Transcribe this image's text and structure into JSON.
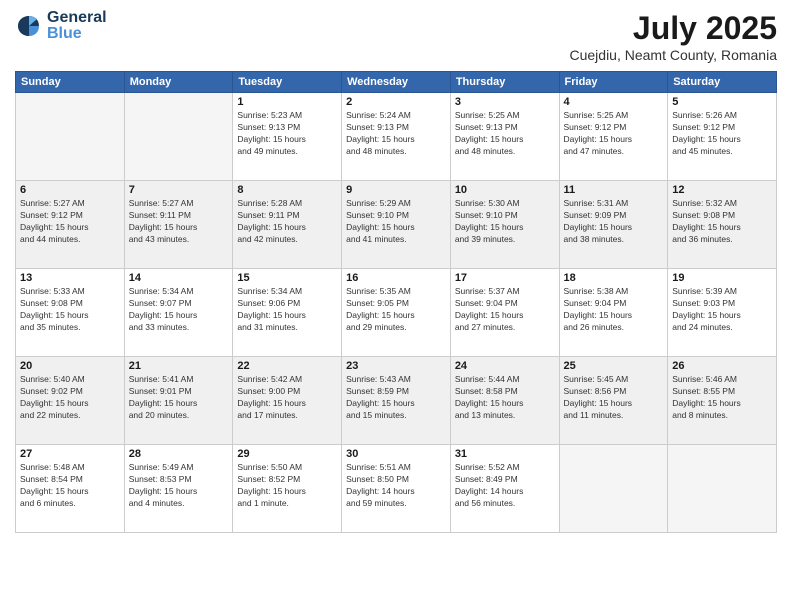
{
  "logo": {
    "general": "General",
    "blue": "Blue"
  },
  "header": {
    "month_year": "July 2025",
    "location": "Cuejdiu, Neamt County, Romania"
  },
  "weekdays": [
    "Sunday",
    "Monday",
    "Tuesday",
    "Wednesday",
    "Thursday",
    "Friday",
    "Saturday"
  ],
  "weeks": [
    [
      {
        "day": "",
        "info": ""
      },
      {
        "day": "",
        "info": ""
      },
      {
        "day": "1",
        "info": "Sunrise: 5:23 AM\nSunset: 9:13 PM\nDaylight: 15 hours\nand 49 minutes."
      },
      {
        "day": "2",
        "info": "Sunrise: 5:24 AM\nSunset: 9:13 PM\nDaylight: 15 hours\nand 48 minutes."
      },
      {
        "day": "3",
        "info": "Sunrise: 5:25 AM\nSunset: 9:13 PM\nDaylight: 15 hours\nand 48 minutes."
      },
      {
        "day": "4",
        "info": "Sunrise: 5:25 AM\nSunset: 9:12 PM\nDaylight: 15 hours\nand 47 minutes."
      },
      {
        "day": "5",
        "info": "Sunrise: 5:26 AM\nSunset: 9:12 PM\nDaylight: 15 hours\nand 45 minutes."
      }
    ],
    [
      {
        "day": "6",
        "info": "Sunrise: 5:27 AM\nSunset: 9:12 PM\nDaylight: 15 hours\nand 44 minutes."
      },
      {
        "day": "7",
        "info": "Sunrise: 5:27 AM\nSunset: 9:11 PM\nDaylight: 15 hours\nand 43 minutes."
      },
      {
        "day": "8",
        "info": "Sunrise: 5:28 AM\nSunset: 9:11 PM\nDaylight: 15 hours\nand 42 minutes."
      },
      {
        "day": "9",
        "info": "Sunrise: 5:29 AM\nSunset: 9:10 PM\nDaylight: 15 hours\nand 41 minutes."
      },
      {
        "day": "10",
        "info": "Sunrise: 5:30 AM\nSunset: 9:10 PM\nDaylight: 15 hours\nand 39 minutes."
      },
      {
        "day": "11",
        "info": "Sunrise: 5:31 AM\nSunset: 9:09 PM\nDaylight: 15 hours\nand 38 minutes."
      },
      {
        "day": "12",
        "info": "Sunrise: 5:32 AM\nSunset: 9:08 PM\nDaylight: 15 hours\nand 36 minutes."
      }
    ],
    [
      {
        "day": "13",
        "info": "Sunrise: 5:33 AM\nSunset: 9:08 PM\nDaylight: 15 hours\nand 35 minutes."
      },
      {
        "day": "14",
        "info": "Sunrise: 5:34 AM\nSunset: 9:07 PM\nDaylight: 15 hours\nand 33 minutes."
      },
      {
        "day": "15",
        "info": "Sunrise: 5:34 AM\nSunset: 9:06 PM\nDaylight: 15 hours\nand 31 minutes."
      },
      {
        "day": "16",
        "info": "Sunrise: 5:35 AM\nSunset: 9:05 PM\nDaylight: 15 hours\nand 29 minutes."
      },
      {
        "day": "17",
        "info": "Sunrise: 5:37 AM\nSunset: 9:04 PM\nDaylight: 15 hours\nand 27 minutes."
      },
      {
        "day": "18",
        "info": "Sunrise: 5:38 AM\nSunset: 9:04 PM\nDaylight: 15 hours\nand 26 minutes."
      },
      {
        "day": "19",
        "info": "Sunrise: 5:39 AM\nSunset: 9:03 PM\nDaylight: 15 hours\nand 24 minutes."
      }
    ],
    [
      {
        "day": "20",
        "info": "Sunrise: 5:40 AM\nSunset: 9:02 PM\nDaylight: 15 hours\nand 22 minutes."
      },
      {
        "day": "21",
        "info": "Sunrise: 5:41 AM\nSunset: 9:01 PM\nDaylight: 15 hours\nand 20 minutes."
      },
      {
        "day": "22",
        "info": "Sunrise: 5:42 AM\nSunset: 9:00 PM\nDaylight: 15 hours\nand 17 minutes."
      },
      {
        "day": "23",
        "info": "Sunrise: 5:43 AM\nSunset: 8:59 PM\nDaylight: 15 hours\nand 15 minutes."
      },
      {
        "day": "24",
        "info": "Sunrise: 5:44 AM\nSunset: 8:58 PM\nDaylight: 15 hours\nand 13 minutes."
      },
      {
        "day": "25",
        "info": "Sunrise: 5:45 AM\nSunset: 8:56 PM\nDaylight: 15 hours\nand 11 minutes."
      },
      {
        "day": "26",
        "info": "Sunrise: 5:46 AM\nSunset: 8:55 PM\nDaylight: 15 hours\nand 8 minutes."
      }
    ],
    [
      {
        "day": "27",
        "info": "Sunrise: 5:48 AM\nSunset: 8:54 PM\nDaylight: 15 hours\nand 6 minutes."
      },
      {
        "day": "28",
        "info": "Sunrise: 5:49 AM\nSunset: 8:53 PM\nDaylight: 15 hours\nand 4 minutes."
      },
      {
        "day": "29",
        "info": "Sunrise: 5:50 AM\nSunset: 8:52 PM\nDaylight: 15 hours\nand 1 minute."
      },
      {
        "day": "30",
        "info": "Sunrise: 5:51 AM\nSunset: 8:50 PM\nDaylight: 14 hours\nand 59 minutes."
      },
      {
        "day": "31",
        "info": "Sunrise: 5:52 AM\nSunset: 8:49 PM\nDaylight: 14 hours\nand 56 minutes."
      },
      {
        "day": "",
        "info": ""
      },
      {
        "day": "",
        "info": ""
      }
    ]
  ]
}
